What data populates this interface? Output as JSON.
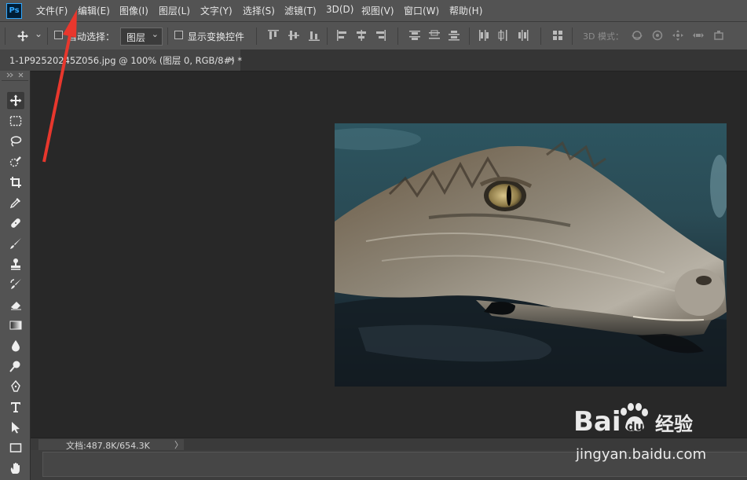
{
  "app": {
    "logo_text": "Ps"
  },
  "menu": [
    "文件(F)",
    "编辑(E)",
    "图像(I)",
    "图层(L)",
    "文字(Y)",
    "选择(S)",
    "滤镜(T)",
    "3D(D)",
    "视图(V)",
    "窗口(W)",
    "帮助(H)"
  ],
  "options": {
    "auto_select_label": "自动选择：",
    "layer_select_value": "图层",
    "show_transform_label": "显示变换控件",
    "mode_3d_label": "3D 模式："
  },
  "tab": {
    "title": "1-1P92520245Z056.jpg @ 100% (图层 0, RGB/8#) *",
    "close": "×"
  },
  "status": {
    "doc_size": "文档:487.8K/654.3K",
    "arrow": "〉"
  },
  "watermark": {
    "text": "jingyan.baidu.com",
    "brand": "Bai",
    "brand2": "du",
    "brand3": "经验"
  },
  "colors": {
    "accent_red": "#e8372d",
    "ps_blue": "#31a8ff"
  },
  "tools": [
    "move-tool",
    "marquee-tool",
    "lasso-tool",
    "quick-selection-tool",
    "crop-tool",
    "eyedropper-tool",
    "healing-brush-tool",
    "brush-tool",
    "clone-stamp-tool",
    "history-brush-tool",
    "eraser-tool",
    "gradient-tool",
    "blur-tool",
    "dodge-tool",
    "pen-tool",
    "type-tool",
    "path-selection-tool",
    "rectangle-tool",
    "hand-tool"
  ]
}
